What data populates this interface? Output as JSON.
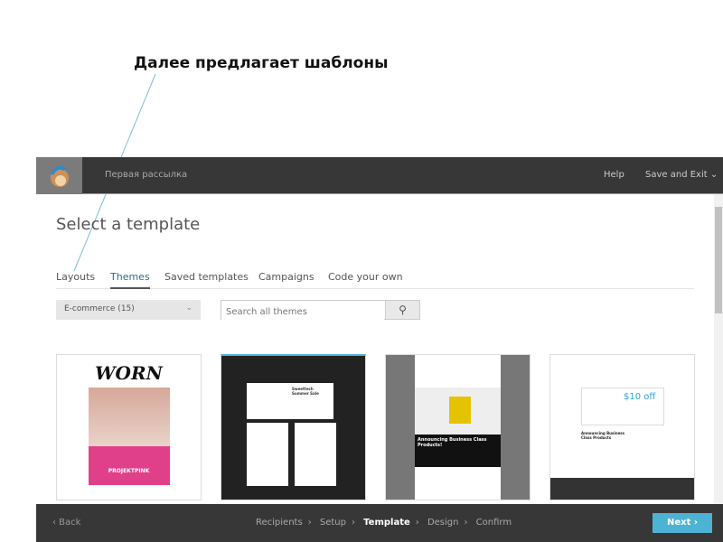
{
  "annotation": {
    "caption": "Далее предлагает шаблоны"
  },
  "topbar": {
    "campaign_name": "Первая рассылка",
    "help": "Help",
    "save_exit": "Save and Exit",
    "save_chevron": "⌄"
  },
  "page": {
    "title": "Select a template"
  },
  "tabs": [
    {
      "label": "Layouts"
    },
    {
      "label": "Themes",
      "active": true
    },
    {
      "label": "Saved templates"
    },
    {
      "label": "Campaigns"
    },
    {
      "label": "Code your own"
    }
  ],
  "filter": {
    "category": "E-commerce (15)",
    "chevron": "⌄"
  },
  "search": {
    "placeholder": "Search all themes",
    "icon": "search-icon"
  },
  "templates": [
    {
      "headline": "WORN",
      "subtitle": "PROJEKTPINK",
      "colors": {
        "accent": "#e0408a"
      }
    },
    {
      "headline": "Sweettech Summer Sale",
      "colors": {
        "bg": "#222222"
      }
    },
    {
      "headline": "Announcing Business Class Products!",
      "colors": {
        "bg": "#777777"
      }
    },
    {
      "headline": "$10 off",
      "subtitle": "Announcing Business Class Products",
      "colors": {
        "accent": "#2a9fd6"
      }
    }
  ],
  "footer": {
    "back": "‹ Back",
    "steps": [
      "Recipients",
      "Setup",
      "Template",
      "Design",
      "Confirm"
    ],
    "current_step": "Template",
    "separator": "›",
    "next": "Next ›"
  },
  "colors": {
    "topbar": "#373737",
    "accent": "#4cb3d4",
    "active_tab": "#2a6f86"
  }
}
